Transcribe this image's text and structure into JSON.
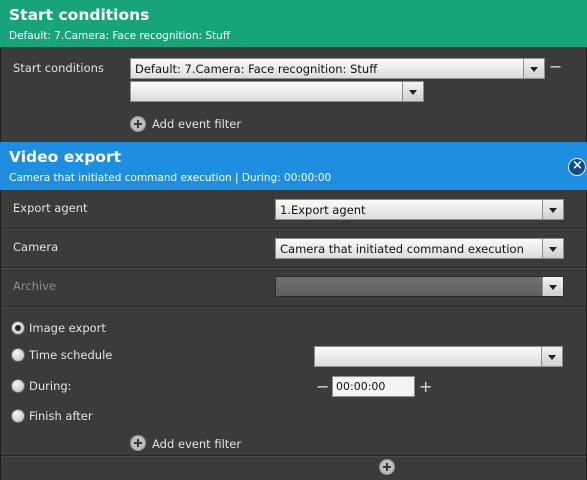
{
  "start_conditions": {
    "title": "Start conditions",
    "subtitle": "Default: 7.Camera: Face recognition: Stuff",
    "label": "Start conditions",
    "condition_value": "Default: 7.Camera: Face recognition: Stuff",
    "filter_value": "",
    "remove_symbol": "−",
    "add_filter_label": "Add event filter"
  },
  "video_export": {
    "title": "Video export",
    "subtitle": "Camera that initiated command execution | During: 00:00:00",
    "export_agent_label": "Export agent",
    "export_agent_value": "1.Export agent",
    "camera_label": "Camera",
    "camera_value": "Camera that initiated command execution",
    "archive_label": "Archive",
    "archive_value": "",
    "options": [
      {
        "label": "Image export",
        "selected": true
      },
      {
        "label": "Time schedule",
        "selected": false
      },
      {
        "label": "During:",
        "selected": false
      },
      {
        "label": "Finish after",
        "selected": false
      }
    ],
    "time_schedule_value": "",
    "during_value": "00:00:00",
    "minus_symbol": "−",
    "plus_symbol": "+",
    "add_filter_label": "Add event filter",
    "close_symbol": "×"
  },
  "colors": {
    "start_header": "#17a47a",
    "export_header": "#1e8fe0",
    "panel_bg": "#3c3c3c"
  }
}
